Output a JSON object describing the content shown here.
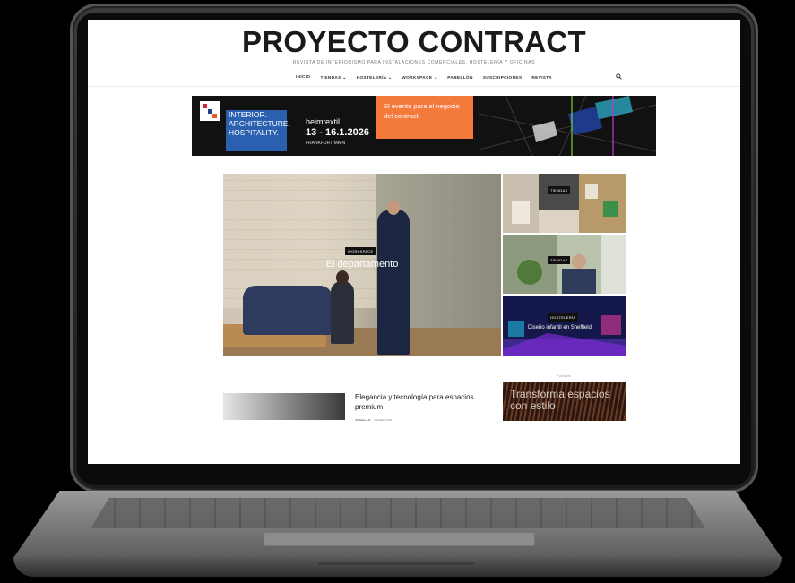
{
  "site": {
    "title": "PROYECTO CONTRACT",
    "tagline": "REVISTA DE INTERIORISMO PARA INSTALACIONES COMERCIALES, HOSTELERÍA Y OFICINAS"
  },
  "nav": {
    "items": [
      {
        "label": "INICIO",
        "active": true
      },
      {
        "label": "TIENDAS ⌄"
      },
      {
        "label": "HOSTELERÍA ⌄"
      },
      {
        "label": "WORKSPACE ⌄"
      },
      {
        "label": "PABELLÓN"
      },
      {
        "label": "SUSCRIPCIONES"
      },
      {
        "label": "REVISTA"
      }
    ],
    "search_icon": "search-icon"
  },
  "banner": {
    "logo_colors": [
      "#d81e2a",
      "#1d3e8a",
      "#e55a21"
    ],
    "fair_lines": [
      "INTERIOR.",
      "ARCHITECTURE.",
      "HOSPITALITY."
    ],
    "fair_brand": "heimtextil",
    "dates": "13 - 16.1.2026",
    "city": "FRANKFURT/MAIN",
    "slogan": "El evento para el negocio del contract."
  },
  "hero": {
    "tag": "WORKSPACE",
    "title": "El departamento"
  },
  "sidebar": [
    {
      "tag": "TIENDAS"
    },
    {
      "tag": "TIENDAS"
    },
    {
      "tag": "HOSTELERÍA",
      "title": "Diseño infantil en Sheffield"
    }
  ],
  "article": {
    "title": "Elegancia y tecnología para espacios premium",
    "meta_label": "TIENDAS",
    "meta_date": "12/09/2025"
  },
  "ad": {
    "label": "Publicidad",
    "text": "Transforma espacios con estilo"
  }
}
